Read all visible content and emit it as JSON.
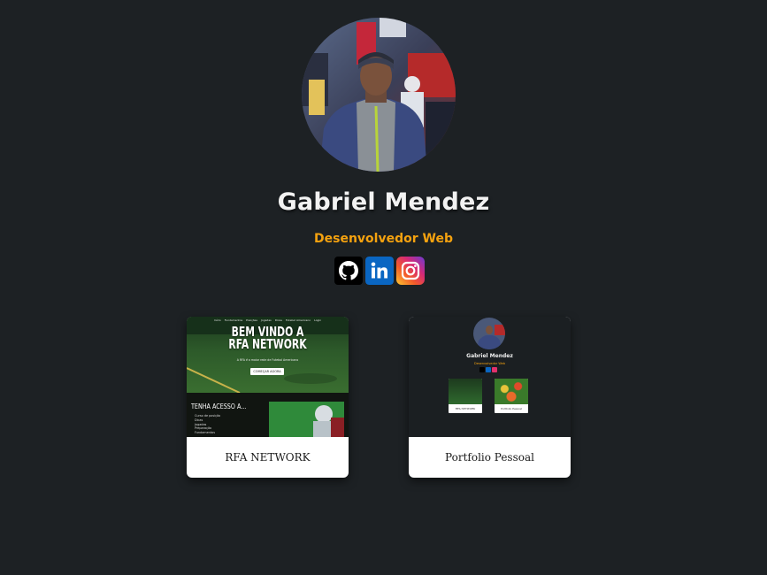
{
  "profile": {
    "name": "Gabriel Mendez",
    "role": "Desenvolvedor Web",
    "avatar_icon": "profile-photo"
  },
  "social": [
    {
      "name": "github",
      "icon": "github-icon",
      "color": "#000000"
    },
    {
      "name": "linkedin",
      "icon": "linkedin-icon",
      "color": "#0a66c2"
    },
    {
      "name": "instagram",
      "icon": "instagram-icon",
      "color": "#e1306c"
    }
  ],
  "projects": [
    {
      "title": "RFA NETWORK",
      "preview": {
        "nav": [
          "Início",
          "Fundamentos",
          "Posições",
          "Jogadas",
          "Dicas",
          "Futebol Americano",
          "Login"
        ],
        "hero_title_1": "BEM VINDO A",
        "hero_title_2": "RFA NETWORK",
        "hero_sub": "A RFA é a maior rede de Futebol Americano",
        "hero_button": "COMEÇAR AGORA",
        "lower_title": "TENHA ACESSO A...",
        "lower_list": [
          "Curso de posição",
          "Dicas",
          "Jogadas",
          "Preparação",
          "Fundamentos"
        ]
      }
    },
    {
      "title": "Portfolio Pessoal",
      "preview": {
        "name": "Gabriel Mendez",
        "role": "Desenvolvedor Web",
        "card1_label": "RFA NETWORK",
        "card2_label": "Portfolio Pessoal"
      }
    }
  ],
  "colors": {
    "background": "#1d2124",
    "accent": "#f5a20f",
    "name_text": "#f2f2f2"
  }
}
